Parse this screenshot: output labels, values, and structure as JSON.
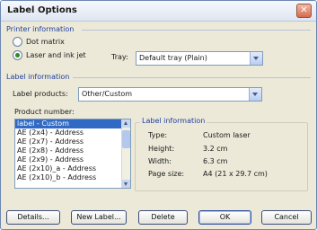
{
  "window": {
    "title": "Label Options"
  },
  "printer_info": {
    "heading": "Printer information",
    "options": [
      {
        "label": "Dot matrix",
        "checked": false
      },
      {
        "label": "Laser and ink jet",
        "checked": true
      }
    ],
    "tray_label": "Tray:",
    "tray_value": "Default tray (Plain)"
  },
  "label_info": {
    "heading": "Label information",
    "products_label": "Label products:",
    "products_value": "Other/Custom",
    "product_number_label": "Product number:",
    "product_list": [
      "label - Custom",
      "AE (2x4) - Address",
      "AE (2x7) - Address",
      "AE (2x8) - Address",
      "AE (2x9) - Address",
      "AE (2x10)_a - Address",
      "AE (2x10)_b - Address"
    ],
    "selected_index": 0
  },
  "label_details": {
    "heading": "Label information",
    "rows": [
      {
        "key": "Type:",
        "value": "Custom laser"
      },
      {
        "key": "Height:",
        "value": "3.2 cm"
      },
      {
        "key": "Width:",
        "value": "6.3 cm"
      },
      {
        "key": "Page size:",
        "value": "A4 (21 x 29.7 cm)"
      }
    ]
  },
  "buttons": {
    "details": "Details...",
    "new_label": "New Label...",
    "delete": "Delete",
    "ok": "OK",
    "cancel": "Cancel"
  }
}
